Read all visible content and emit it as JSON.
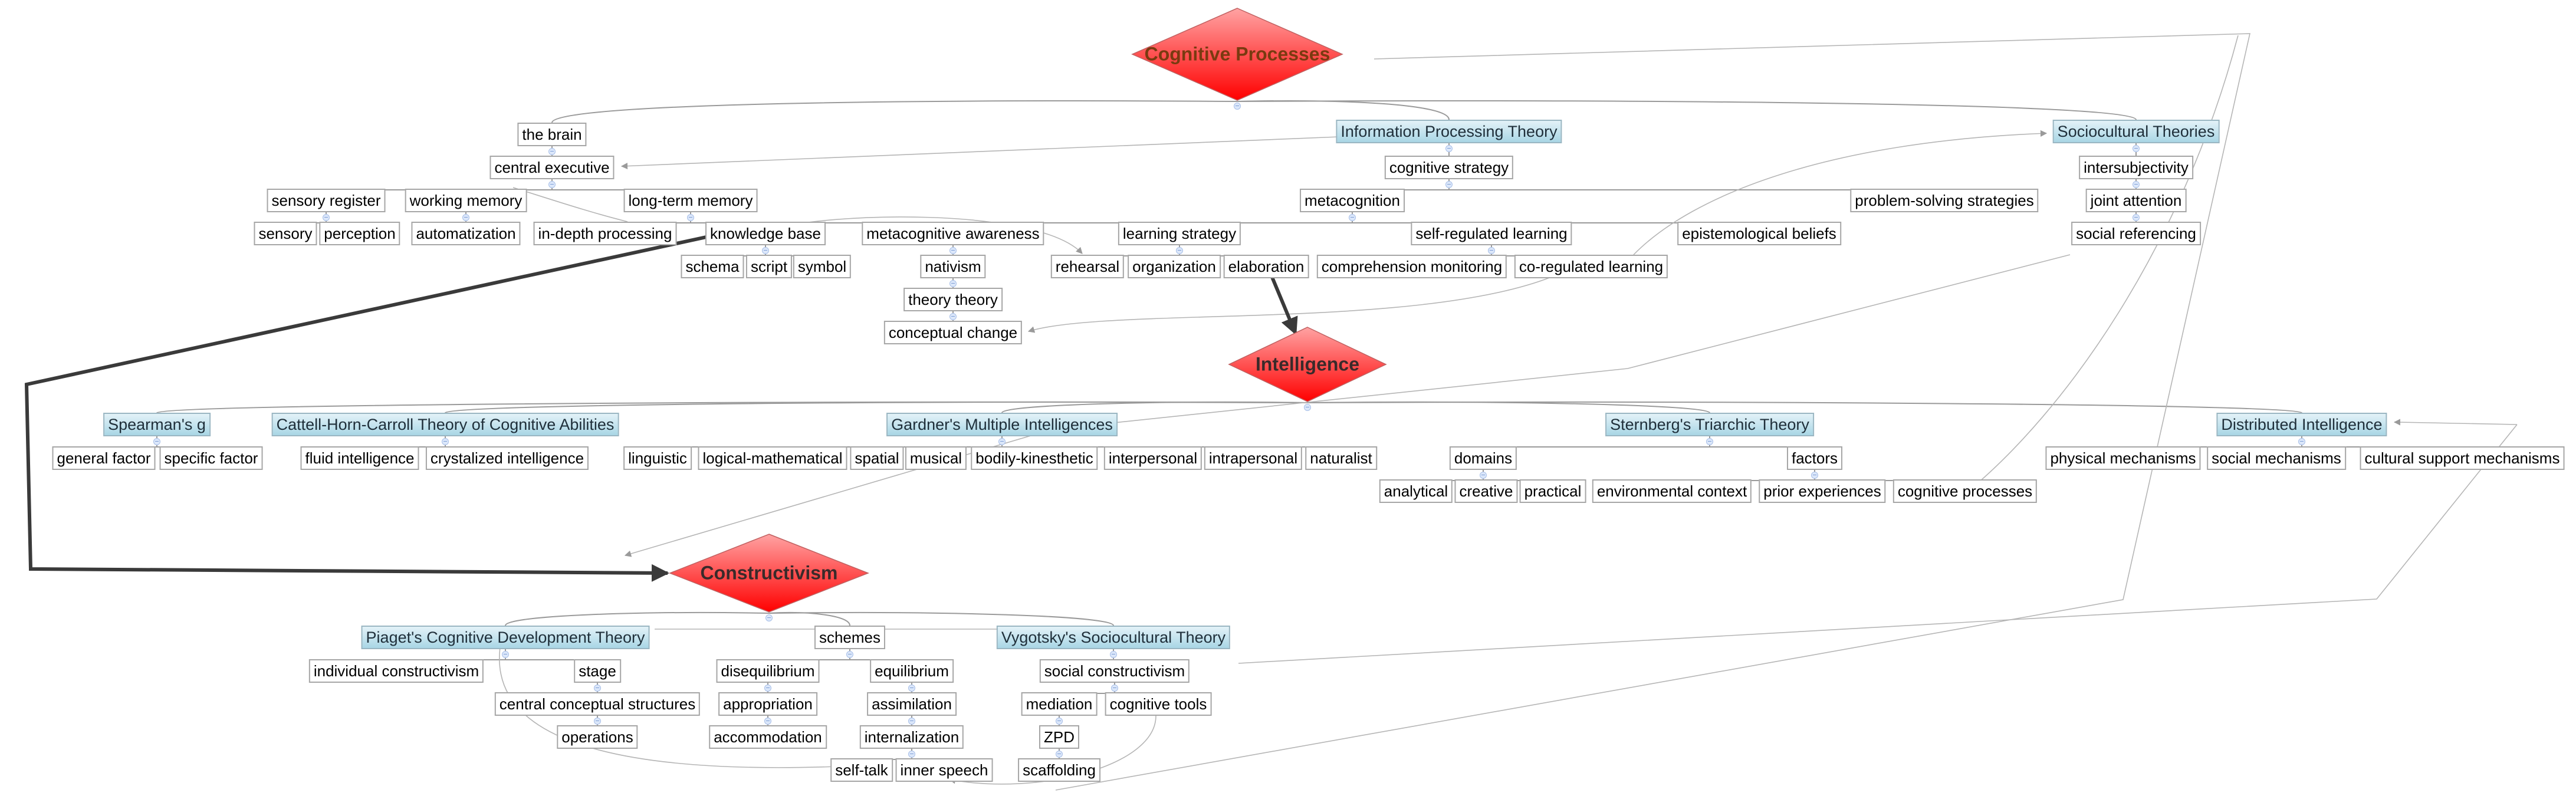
{
  "colors": {
    "diamond_top": "#ff9f9f",
    "diamond_bottom": "#ff0000",
    "diamond_label_cognitive": "#7a3a10",
    "diamond_label": "#3a2a2a",
    "theory_fill_top": "#e3f2f8",
    "theory_fill_bottom": "#a9d6e5",
    "edge": "#9a9a9a",
    "heavy_edge": "#3a3a3a"
  },
  "hubs": {
    "cognitive_processes": "Cognitive Processes",
    "intelligence": "Intelligence",
    "constructivism": "Constructivism"
  },
  "nodes": {
    "the_brain": "the brain",
    "central_executive": "central executive",
    "sensory_register": "sensory register",
    "working_memory": "working memory",
    "long_term_memory": "long-term memory",
    "sensory": "sensory",
    "perception": "perception",
    "automatization": "automatization",
    "in_depth_processing": "in-depth processing",
    "knowledge_base": "knowledge base",
    "schema": "schema",
    "script": "script",
    "symbol": "symbol",
    "information_processing_theory": "Information Processing Theory",
    "cognitive_strategy": "cognitive strategy",
    "metacognition": "metacognition",
    "problem_solving_strategies": "problem-solving strategies",
    "metacognitive_awareness": "metacognitive awareness",
    "nativism": "nativism",
    "theory_theory": "theory theory",
    "conceptual_change": "conceptual change",
    "learning_strategy": "learning strategy",
    "rehearsal": "rehearsal",
    "organization": "organization",
    "elaboration": "elaboration",
    "self_regulated_learning": "self-regulated learning",
    "comprehension_monitoring": "comprehension monitoring",
    "co_regulated_learning": "co-regulated learning",
    "epistemological_beliefs": "epistemological beliefs",
    "sociocultural_theories": "Sociocultural Theories",
    "intersubjectivity": "intersubjectivity",
    "joint_attention": "joint attention",
    "social_referencing": "social referencing",
    "spearmans_g": "Spearman's g",
    "general_factor": "general factor",
    "specific_factor": "specific factor",
    "chc_theory": "Cattell-Horn-Carroll Theory of Cognitive Abilities",
    "fluid_intelligence": "fluid intelligence",
    "crystalized_intelligence": "crystalized intelligence",
    "gardners_mi": "Gardner's Multiple Intelligences",
    "linguistic": "linguistic",
    "logical_mathematical": "logical-mathematical",
    "spatial": "spatial",
    "musical": "musical",
    "bodily_kinesthetic": "bodily-kinesthetic",
    "interpersonal": "interpersonal",
    "intrapersonal": "intrapersonal",
    "naturalist": "naturalist",
    "sternbergs_triarchic": "Sternberg's Triarchic Theory",
    "domains": "domains",
    "factors": "factors",
    "analytical": "analytical",
    "creative": "creative",
    "practical": "practical",
    "environmental_context": "environmental context",
    "prior_experiences": "prior experiences",
    "cognitive_processes_leaf": "cognitive processes",
    "distributed_intelligence": "Distributed Intelligence",
    "physical_mechanisms": "physical mechanisms",
    "social_mechanisms": "social mechanisms",
    "cultural_support_mechanisms": "cultural support mechanisms",
    "piagets_theory": "Piaget's Cognitive Development Theory",
    "individual_constructivism": "individual constructivism",
    "stage": "stage",
    "central_conceptual_structures": "central conceptual structures",
    "operations": "operations",
    "schemes": "schemes",
    "disequilibrium": "disequilibrium",
    "appropriation": "appropriation",
    "accommodation": "accommodation",
    "equilibrium": "equilibrium",
    "assimilation": "assimilation",
    "internalization": "internalization",
    "self_talk": "self-talk",
    "inner_speech": "inner speech",
    "vygotskys_theory": "Vygotsky's Sociocultural Theory",
    "social_constructivism": "social constructivism",
    "mediation": "mediation",
    "cognitive_tools": "cognitive tools",
    "zpd": "ZPD",
    "scaffolding": "scaffolding"
  }
}
